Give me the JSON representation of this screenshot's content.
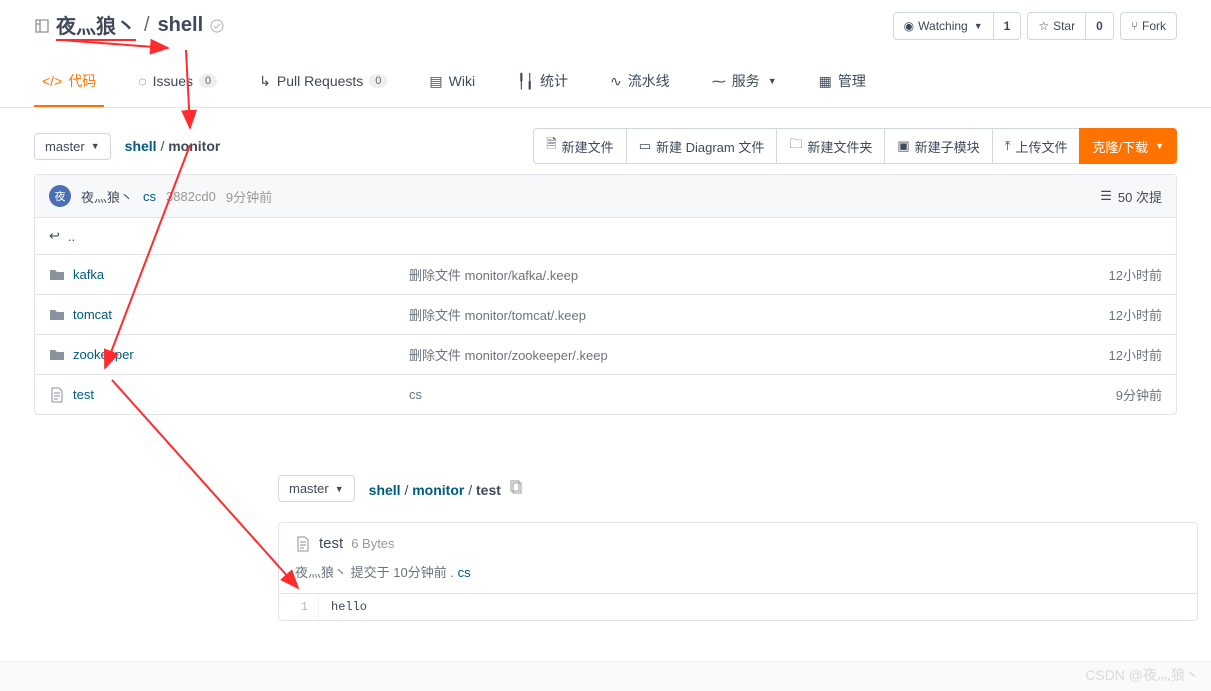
{
  "header": {
    "owner": "夜灬狼丶",
    "sep": "/",
    "repo": "shell",
    "actions": {
      "watch_label": "Watching",
      "watch_count": "1",
      "star_label": "Star",
      "star_count": "0",
      "fork_label": "Fork"
    }
  },
  "tabs": {
    "code": "代码",
    "issues": "Issues",
    "issues_count": "0",
    "pr": "Pull Requests",
    "pr_count": "0",
    "wiki": "Wiki",
    "stats": "统计",
    "pipeline": "流水线",
    "services": "服务",
    "admin": "管理"
  },
  "toolbar": {
    "branch": "master",
    "crumb_root": "shell",
    "crumb_cur": "monitor",
    "new_file": "新建文件",
    "new_diagram": "新建 Diagram 文件",
    "new_folder": "新建文件夹",
    "new_submodule": "新建子模块",
    "upload": "上传文件",
    "clone": "克隆/下载"
  },
  "commit_bar": {
    "avatar_char": "夜",
    "author": "夜灬狼丶",
    "msg": "cs",
    "sha": "3882cd0",
    "time": "9分钟前",
    "commits": "50 次提"
  },
  "files": [
    {
      "type": "back",
      "name": ".."
    },
    {
      "type": "dir",
      "name": "kafka",
      "msg": "删除文件 monitor/kafka/.keep",
      "time": "12小时前"
    },
    {
      "type": "dir",
      "name": "tomcat",
      "msg": "删除文件 monitor/tomcat/.keep",
      "time": "12小时前"
    },
    {
      "type": "dir",
      "name": "zookeeper",
      "msg": "删除文件 monitor/zookeeper/.keep",
      "time": "12小时前"
    },
    {
      "type": "file",
      "name": "test",
      "msg": "cs",
      "time": "9分钟前"
    }
  ],
  "second": {
    "branch": "master",
    "crumb_root": "shell",
    "crumb_mid": "monitor",
    "crumb_cur": "test",
    "filename": "test",
    "filesize": "6 Bytes",
    "author": "夜灬狼丶",
    "commit_prefix": "提交于",
    "commit_time": "10分钟前",
    "dot": ".",
    "commit_msg": "cs",
    "lineno": "1",
    "code": "hello"
  },
  "watermark": "CSDN @夜灬狼丶"
}
